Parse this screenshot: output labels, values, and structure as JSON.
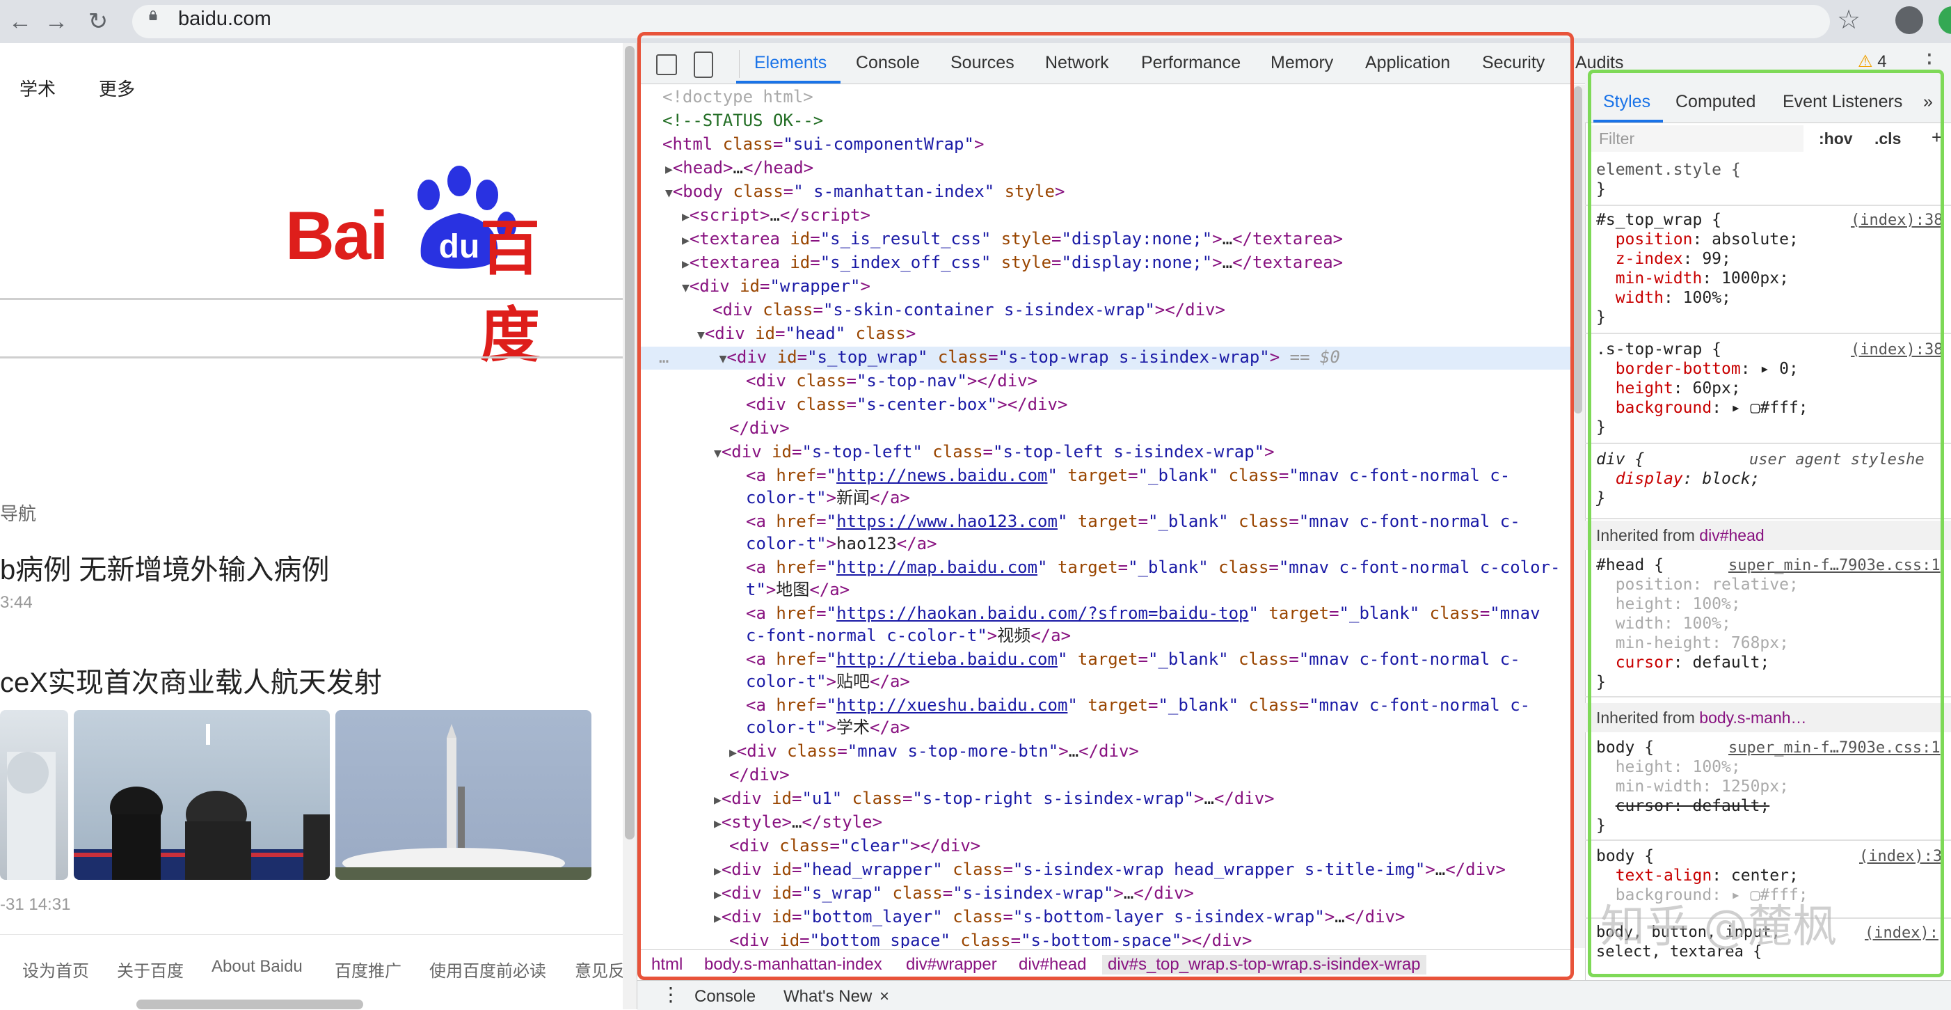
{
  "browser": {
    "url": "baidu.com"
  },
  "page": {
    "top_nav": [
      "学术",
      "更多"
    ],
    "logo": {
      "latin": "Bai",
      "du": "du",
      "chinese": "百度"
    },
    "nav_label": "导航",
    "news": [
      {
        "title": "b病例 无新增境外输入病例",
        "time": "3:44"
      },
      {
        "title": "ceX实现首次商业载人航天发射",
        "time": "-31 14:31"
      }
    ],
    "footer_links": [
      "设为首页",
      "关于百度",
      "About Baidu",
      "百度推广",
      "使用百度前必读",
      "意见反"
    ]
  },
  "devtools": {
    "tabs": [
      "Elements",
      "Console",
      "Sources",
      "Network",
      "Performance",
      "Memory",
      "Application",
      "Security",
      "Audits"
    ],
    "active_tab": "Elements",
    "warnings": "4",
    "breadcrumb": [
      "html",
      "body.s-manhattan-index",
      "div#wrapper",
      "div#head",
      "div#s_top_wrap.s-top-wrap.s-isindex-wrap"
    ],
    "drawer": {
      "tabs": [
        "Console",
        "What's New"
      ],
      "close": "×"
    },
    "styles_tabs": [
      "Styles",
      "Computed",
      "Event Listeners",
      "»"
    ],
    "filter_placeholder": "Filter",
    "hov": ":hov",
    "cls": ".cls",
    "plus": "+",
    "element_style": "element.style {",
    "inherited_head": "Inherited from ",
    "inherited_head_tag": "div#head",
    "inherited_body_tag": "body.s-manh…",
    "watermark": "知乎 @麓枫"
  },
  "colors": {
    "baidu_red": "#de1e1b",
    "baidu_blue": "#2932e1",
    "devtools_blue": "#1a73e8",
    "annotation_red": "#e8533a",
    "annotation_green": "#7ed957"
  }
}
